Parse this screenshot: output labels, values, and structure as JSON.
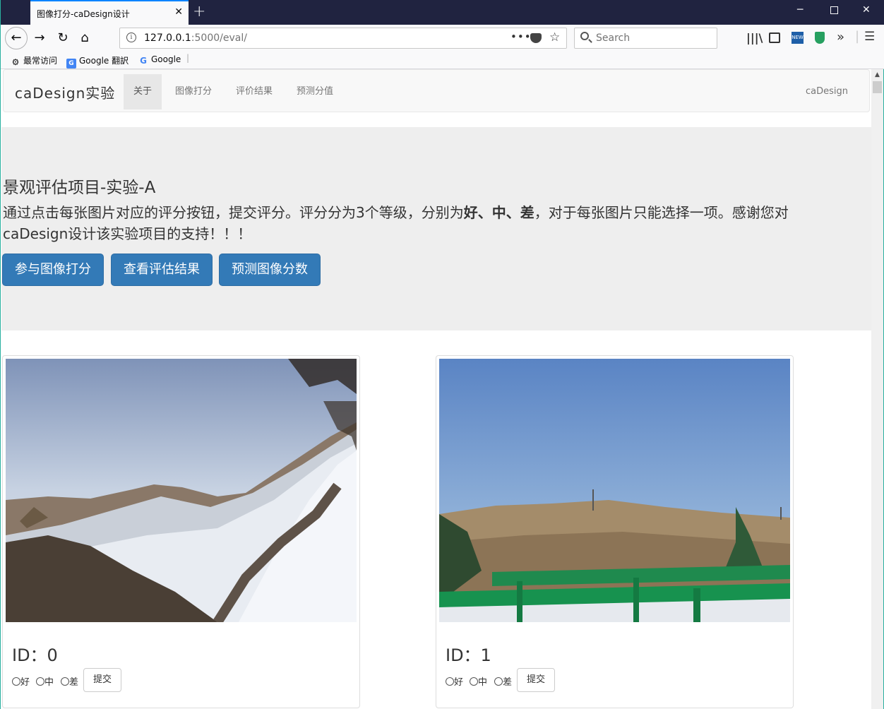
{
  "browser": {
    "tab_title": "图像打分-caDesign设计",
    "url_host": "127.0.0.1",
    "url_path": ":5000/eval/",
    "search_placeholder": "Search",
    "bookmarks": [
      "最常访问",
      "Google 翻訳",
      "Google"
    ]
  },
  "navbar": {
    "brand": "caDesign实验",
    "items": [
      "关于",
      "图像打分",
      "评价结果",
      "预测分值"
    ],
    "right": "caDesign"
  },
  "jumbotron": {
    "title": "景观评估项目-实验-A",
    "desc_before": "通过点击每张图片对应的评分按钮，提交评分。评分分为3个等级，分别为",
    "desc_bold": "好、中、差",
    "desc_after": "，对于每张图片只能选择一项。感谢您对caDesign设计该实验项目的支持！！！",
    "buttons": [
      "参与图像打分",
      "查看评估结果",
      "预测图像分数"
    ]
  },
  "cards": [
    {
      "id_label": "ID：0",
      "options": [
        "好",
        "中",
        "差"
      ],
      "submit": "提交"
    },
    {
      "id_label": "ID：1",
      "options": [
        "好",
        "中",
        "差"
      ],
      "submit": "提交"
    }
  ],
  "colors": {
    "primary": "#337ab7",
    "titlebar": "#202340",
    "jumbotron": "#eeeeee"
  }
}
